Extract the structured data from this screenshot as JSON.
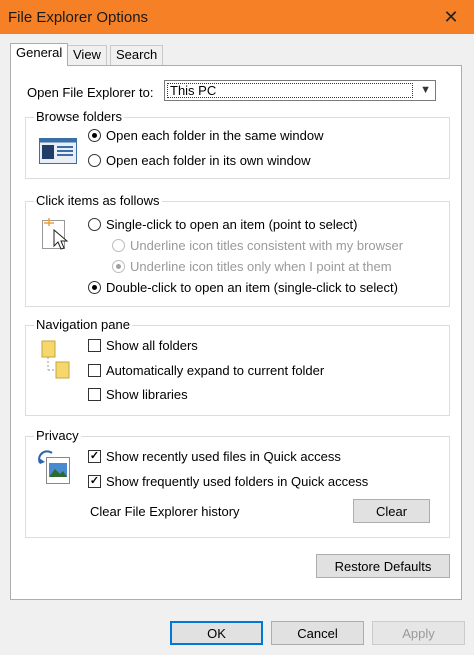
{
  "window": {
    "title": "File Explorer Options",
    "close_icon": "close-icon"
  },
  "tabs": [
    {
      "label": "General",
      "active": true
    },
    {
      "label": "View",
      "active": false
    },
    {
      "label": "Search",
      "active": false
    }
  ],
  "general": {
    "open_label": "Open File Explorer to:",
    "open_value": "This PC",
    "browse": {
      "title": "Browse folders",
      "same_window": "Open each folder in the same window",
      "own_window": "Open each folder in its own window",
      "selected": "same_window"
    },
    "click": {
      "title": "Click items as follows",
      "single": "Single-click to open an item (point to select)",
      "underline_browser": "Underline icon titles consistent with my browser",
      "underline_point": "Underline icon titles only when I point at them",
      "double": "Double-click to open an item (single-click to select)",
      "selected": "double"
    },
    "nav": {
      "title": "Navigation pane",
      "show_all": "Show all folders",
      "auto_expand": "Automatically expand to current folder",
      "show_libraries": "Show libraries"
    },
    "privacy": {
      "title": "Privacy",
      "recent_files": "Show recently used files in Quick access",
      "frequent_folders": "Show frequently used folders in Quick access",
      "clear_label": "Clear File Explorer history",
      "clear_button": "Clear"
    },
    "restore_defaults": "Restore Defaults"
  },
  "footer": {
    "ok": "OK",
    "cancel": "Cancel",
    "apply": "Apply"
  },
  "colors": {
    "titlebar": "#f58026",
    "default_button_border": "#0078d7"
  }
}
